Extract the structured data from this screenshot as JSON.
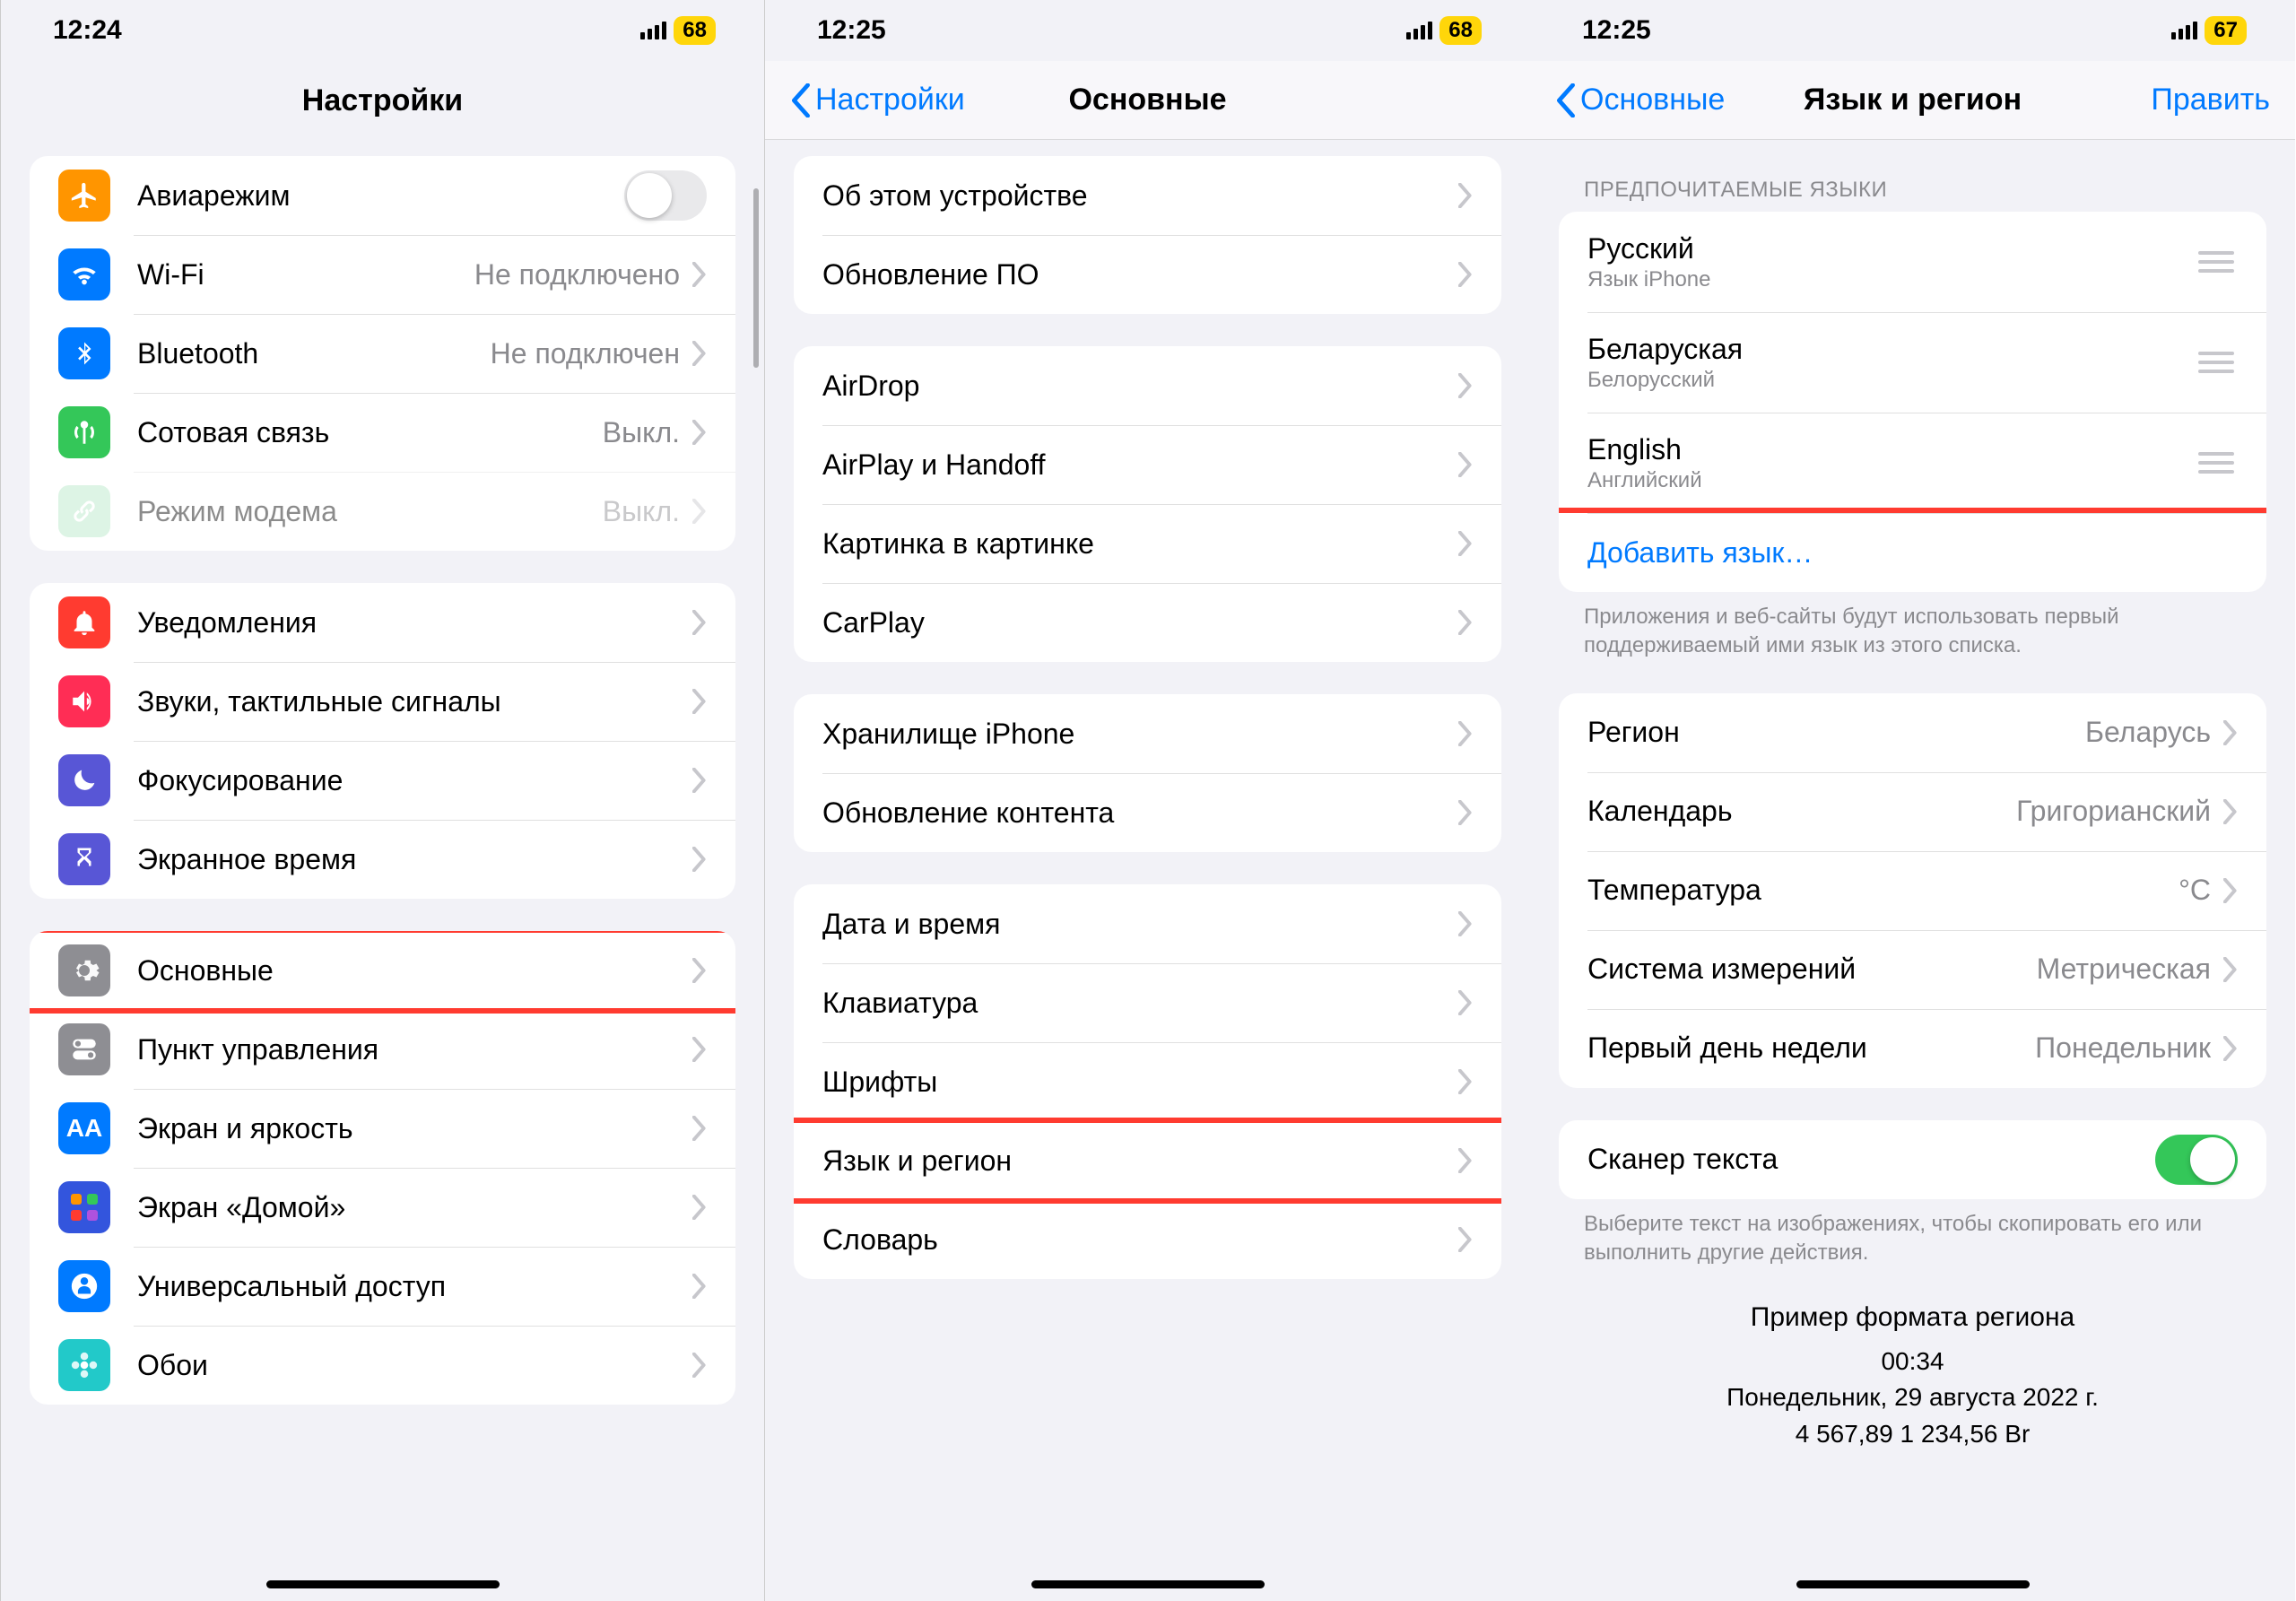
{
  "p1": {
    "time": "12:24",
    "battery": "68",
    "title": "Настройки",
    "g1": [
      {
        "name": "airplane",
        "label": "Авиарежим",
        "type": "toggle",
        "on": false,
        "color": "#ff9500",
        "glyph": "plane"
      },
      {
        "name": "wifi",
        "label": "Wi-Fi",
        "value": "Не подключено",
        "color": "#007aff",
        "glyph": "wifi"
      },
      {
        "name": "bluetooth",
        "label": "Bluetooth",
        "value": "Не подключен",
        "color": "#007aff",
        "glyph": "bt"
      },
      {
        "name": "cellular",
        "label": "Сотовая связь",
        "value": "Выкл.",
        "color": "#34c759",
        "glyph": "antenna"
      },
      {
        "name": "hotspot",
        "label": "Режим модема",
        "value": "Выкл.",
        "color": "#b4e7c5",
        "glyph": "link",
        "dim": true
      }
    ],
    "g2": [
      {
        "name": "notifications",
        "label": "Уведомления",
        "color": "#ff3b30",
        "glyph": "bell"
      },
      {
        "name": "sounds",
        "label": "Звуки, тактильные сигналы",
        "color": "#ff2d55",
        "glyph": "speaker"
      },
      {
        "name": "focus",
        "label": "Фокусирование",
        "color": "#5856d6",
        "glyph": "moon"
      },
      {
        "name": "screen-time",
        "label": "Экранное время",
        "color": "#5856d6",
        "glyph": "hourglass"
      }
    ],
    "g3": [
      {
        "name": "general",
        "label": "Основные",
        "color": "#8e8e93",
        "glyph": "gear",
        "highlight": true
      },
      {
        "name": "control-center",
        "label": "Пункт управления",
        "color": "#8e8e93",
        "glyph": "switches"
      },
      {
        "name": "display",
        "label": "Экран и яркость",
        "color": "#007aff",
        "glyph": "aa"
      },
      {
        "name": "home-screen",
        "label": "Экран «Домой»",
        "color": "#3355dd",
        "glyph": "grid"
      },
      {
        "name": "accessibility",
        "label": "Универсальный доступ",
        "color": "#007aff",
        "glyph": "person"
      },
      {
        "name": "wallpaper",
        "label": "Обои",
        "color": "#22c9c9",
        "glyph": "flower"
      }
    ]
  },
  "p2": {
    "time": "12:25",
    "battery": "68",
    "back": "Настройки",
    "title": "Основные",
    "g1": [
      {
        "name": "about",
        "label": "Об этом устройстве"
      },
      {
        "name": "software-update",
        "label": "Обновление ПО"
      }
    ],
    "g2": [
      {
        "name": "airdrop",
        "label": "AirDrop"
      },
      {
        "name": "airplay",
        "label": "AirPlay и Handoff"
      },
      {
        "name": "pip",
        "label": "Картинка в картинке"
      },
      {
        "name": "carplay",
        "label": "CarPlay"
      }
    ],
    "g3": [
      {
        "name": "storage",
        "label": "Хранилище iPhone"
      },
      {
        "name": "background-refresh",
        "label": "Обновление контента"
      }
    ],
    "g4": [
      {
        "name": "date-time",
        "label": "Дата и время"
      },
      {
        "name": "keyboard",
        "label": "Клавиатура"
      },
      {
        "name": "fonts",
        "label": "Шрифты"
      },
      {
        "name": "language-region",
        "label": "Язык и регион",
        "highlight": true
      },
      {
        "name": "dictionary",
        "label": "Словарь"
      }
    ]
  },
  "p3": {
    "time": "12:25",
    "battery": "67",
    "back": "Основные",
    "title": "Язык и регион",
    "edit": "Править",
    "langs_header": "ПРЕДПОЧИТАЕМЫЕ ЯЗЫКИ",
    "langs": [
      {
        "name": "russian",
        "label": "Русский",
        "sub": "Язык iPhone"
      },
      {
        "name": "belarusian",
        "label": "Беларуская",
        "sub": "Белорусский"
      },
      {
        "name": "english",
        "label": "English",
        "sub": "Английский"
      }
    ],
    "add_lang": "Добавить язык…",
    "langs_footer": "Приложения и веб-сайты будут использовать первый поддерживаемый ими язык из этого списка.",
    "regional": [
      {
        "name": "region",
        "label": "Регион",
        "value": "Беларусь"
      },
      {
        "name": "calendar",
        "label": "Календарь",
        "value": "Григорианский"
      },
      {
        "name": "temperature",
        "label": "Температура",
        "value": "°C"
      },
      {
        "name": "measurement",
        "label": "Система измерений",
        "value": "Метрическая"
      },
      {
        "name": "first-day",
        "label": "Первый день недели",
        "value": "Понедельник"
      }
    ],
    "text_scan": "Сканер текста",
    "text_scan_footer": "Выберите текст на изображениях, чтобы скопировать его или выполнить другие действия.",
    "example_h": "Пример формата региона",
    "example_l1": "00:34",
    "example_l2": "Понедельник, 29 августа 2022 г.",
    "example_l3": "4 567,89 1 234,56 Br"
  }
}
